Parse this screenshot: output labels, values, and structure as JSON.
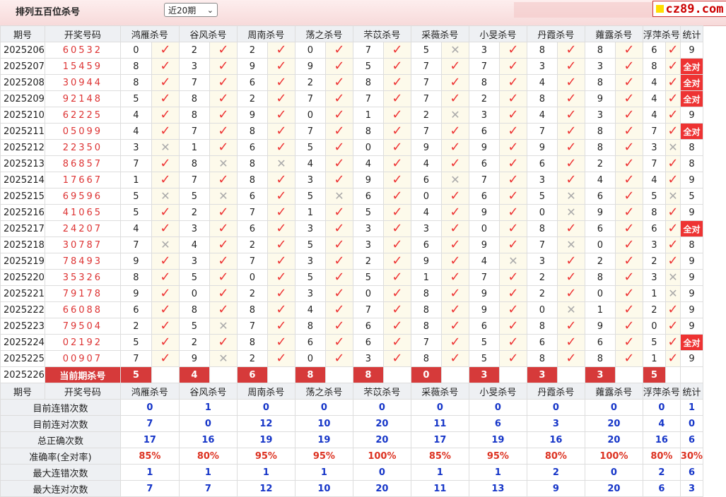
{
  "header": {
    "title": "排列五百位杀号",
    "period_select": "近20期",
    "logo_text": "cz89.com"
  },
  "columns": {
    "issue": "期号",
    "draw": "开奖号码",
    "experts": [
      "鸿雁杀号",
      "谷风杀号",
      "周南杀号",
      "荡之杀号",
      "芣苡杀号",
      "采薇杀号",
      "小旻杀号",
      "丹霞杀号",
      "蕹露杀号",
      "浮萍杀号"
    ],
    "stat": "统计"
  },
  "rows": [
    {
      "issue": "2025206",
      "draw": "60532",
      "kills": [
        0,
        2,
        2,
        0,
        7,
        5,
        3,
        8,
        8,
        6
      ],
      "ok": [
        1,
        1,
        1,
        1,
        1,
        0,
        1,
        1,
        1,
        1
      ],
      "stat": "9"
    },
    {
      "issue": "2025207",
      "draw": "15459",
      "kills": [
        8,
        3,
        9,
        9,
        5,
        7,
        7,
        3,
        3,
        8
      ],
      "ok": [
        1,
        1,
        1,
        1,
        1,
        1,
        1,
        1,
        1,
        1
      ],
      "stat": "全对"
    },
    {
      "issue": "2025208",
      "draw": "30944",
      "kills": [
        8,
        7,
        6,
        2,
        8,
        7,
        8,
        4,
        8,
        4
      ],
      "ok": [
        1,
        1,
        1,
        1,
        1,
        1,
        1,
        1,
        1,
        1
      ],
      "stat": "全对"
    },
    {
      "issue": "2025209",
      "draw": "92148",
      "kills": [
        5,
        8,
        2,
        7,
        7,
        7,
        2,
        8,
        9,
        4
      ],
      "ok": [
        1,
        1,
        1,
        1,
        1,
        1,
        1,
        1,
        1,
        1
      ],
      "stat": "全对"
    },
    {
      "issue": "2025210",
      "draw": "62225",
      "kills": [
        4,
        8,
        9,
        0,
        1,
        2,
        3,
        4,
        3,
        4
      ],
      "ok": [
        1,
        1,
        1,
        1,
        1,
        0,
        1,
        1,
        1,
        1
      ],
      "stat": "9"
    },
    {
      "issue": "2025211",
      "draw": "05099",
      "kills": [
        4,
        7,
        8,
        7,
        8,
        7,
        6,
        7,
        8,
        7
      ],
      "ok": [
        1,
        1,
        1,
        1,
        1,
        1,
        1,
        1,
        1,
        1
      ],
      "stat": "全对"
    },
    {
      "issue": "2025212",
      "draw": "22350",
      "kills": [
        3,
        1,
        6,
        5,
        0,
        9,
        9,
        9,
        8,
        3
      ],
      "ok": [
        0,
        1,
        1,
        1,
        1,
        1,
        1,
        1,
        1,
        0
      ],
      "stat": "8"
    },
    {
      "issue": "2025213",
      "draw": "86857",
      "kills": [
        7,
        8,
        8,
        4,
        4,
        4,
        6,
        6,
        2,
        7
      ],
      "ok": [
        1,
        0,
        0,
        1,
        1,
        1,
        1,
        1,
        1,
        1
      ],
      "stat": "8"
    },
    {
      "issue": "2025214",
      "draw": "17667",
      "kills": [
        1,
        7,
        8,
        3,
        9,
        6,
        7,
        3,
        4,
        4
      ],
      "ok": [
        1,
        1,
        1,
        1,
        1,
        0,
        1,
        1,
        1,
        1
      ],
      "stat": "9"
    },
    {
      "issue": "2025215",
      "draw": "69596",
      "kills": [
        5,
        5,
        6,
        5,
        6,
        0,
        6,
        5,
        6,
        5
      ],
      "ok": [
        0,
        0,
        1,
        0,
        1,
        1,
        1,
        0,
        1,
        0
      ],
      "stat": "5"
    },
    {
      "issue": "2025216",
      "draw": "41065",
      "kills": [
        5,
        2,
        7,
        1,
        5,
        4,
        9,
        0,
        9,
        8
      ],
      "ok": [
        1,
        1,
        1,
        1,
        1,
        1,
        1,
        0,
        1,
        1
      ],
      "stat": "9"
    },
    {
      "issue": "2025217",
      "draw": "24207",
      "kills": [
        4,
        3,
        6,
        3,
        3,
        3,
        0,
        8,
        6,
        6
      ],
      "ok": [
        1,
        1,
        1,
        1,
        1,
        1,
        1,
        1,
        1,
        1
      ],
      "stat": "全对"
    },
    {
      "issue": "2025218",
      "draw": "30787",
      "kills": [
        7,
        4,
        2,
        5,
        3,
        6,
        9,
        7,
        0,
        3
      ],
      "ok": [
        0,
        1,
        1,
        1,
        1,
        1,
        1,
        0,
        1,
        1
      ],
      "stat": "8"
    },
    {
      "issue": "2025219",
      "draw": "78493",
      "kills": [
        9,
        3,
        7,
        3,
        2,
        9,
        4,
        3,
        2,
        2
      ],
      "ok": [
        1,
        1,
        1,
        1,
        1,
        1,
        0,
        1,
        1,
        1
      ],
      "stat": "9"
    },
    {
      "issue": "2025220",
      "draw": "35326",
      "kills": [
        8,
        5,
        0,
        5,
        5,
        1,
        7,
        2,
        8,
        3
      ],
      "ok": [
        1,
        1,
        1,
        1,
        1,
        1,
        1,
        1,
        1,
        0
      ],
      "stat": "9"
    },
    {
      "issue": "2025221",
      "draw": "79178",
      "kills": [
        9,
        0,
        2,
        3,
        0,
        8,
        9,
        2,
        0,
        1
      ],
      "ok": [
        1,
        1,
        1,
        1,
        1,
        1,
        1,
        1,
        1,
        0
      ],
      "stat": "9"
    },
    {
      "issue": "2025222",
      "draw": "66088",
      "kills": [
        6,
        8,
        8,
        4,
        7,
        8,
        9,
        0,
        1,
        2
      ],
      "ok": [
        1,
        1,
        1,
        1,
        1,
        1,
        1,
        0,
        1,
        1
      ],
      "stat": "9"
    },
    {
      "issue": "2025223",
      "draw": "79504",
      "kills": [
        2,
        5,
        7,
        8,
        6,
        8,
        6,
        8,
        9,
        0
      ],
      "ok": [
        1,
        0,
        1,
        1,
        1,
        1,
        1,
        1,
        1,
        1
      ],
      "stat": "9"
    },
    {
      "issue": "2025224",
      "draw": "02192",
      "kills": [
        5,
        2,
        8,
        6,
        6,
        7,
        5,
        6,
        6,
        5
      ],
      "ok": [
        1,
        1,
        1,
        1,
        1,
        1,
        1,
        1,
        1,
        1
      ],
      "stat": "全对"
    },
    {
      "issue": "2025225",
      "draw": "00907",
      "kills": [
        7,
        9,
        2,
        0,
        3,
        8,
        5,
        8,
        8,
        1
      ],
      "ok": [
        1,
        0,
        1,
        1,
        1,
        1,
        1,
        1,
        1,
        1
      ],
      "stat": "9"
    }
  ],
  "current": {
    "issue": "2025226",
    "label": "当前期杀号",
    "kills": [
      5,
      4,
      6,
      8,
      8,
      0,
      3,
      3,
      3,
      5
    ]
  },
  "stats": [
    {
      "label": "目前连错次数",
      "values": [
        "0",
        "1",
        "0",
        "0",
        "0",
        "0",
        "0",
        "0",
        "0",
        "0"
      ],
      "total": "1"
    },
    {
      "label": "目前连对次数",
      "values": [
        "7",
        "0",
        "12",
        "10",
        "20",
        "11",
        "6",
        "3",
        "20",
        "4"
      ],
      "total": "0"
    },
    {
      "label": "总正确次数",
      "values": [
        "17",
        "16",
        "19",
        "19",
        "20",
        "17",
        "19",
        "16",
        "20",
        "16"
      ],
      "total": "6"
    },
    {
      "label": "准确率(全对率)",
      "values": [
        "85%",
        "80%",
        "95%",
        "95%",
        "100%",
        "85%",
        "95%",
        "80%",
        "100%",
        "80%"
      ],
      "total": "30%"
    },
    {
      "label": "最大连错次数",
      "values": [
        "1",
        "1",
        "1",
        "1",
        "0",
        "1",
        "1",
        "2",
        "0",
        "2"
      ],
      "total": "6"
    },
    {
      "label": "最大连对次数",
      "values": [
        "7",
        "7",
        "12",
        "10",
        "20",
        "11",
        "13",
        "9",
        "20",
        "6"
      ],
      "total": "3"
    }
  ],
  "colors": {
    "accent": "#e33",
    "stat_blue": "#1535c8",
    "rate_red": "#d32",
    "header_bg": "#eef0f3",
    "check_bg": "#fdfaeb"
  }
}
